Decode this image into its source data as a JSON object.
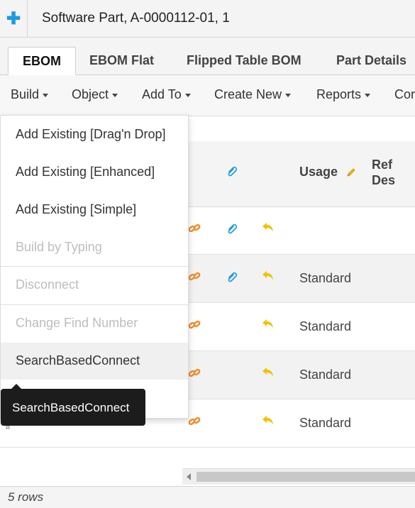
{
  "header": {
    "add_icon": "plus-icon",
    "title": "Software Part, A-0000112-01, 1"
  },
  "tabs": [
    {
      "label": "EBOM",
      "active": true
    },
    {
      "label": "EBOM Flat"
    },
    {
      "label": "Flipped Table BOM"
    },
    {
      "label": "Part Details"
    }
  ],
  "toolbar": {
    "menus": [
      "Build",
      "Object",
      "Add To",
      "Create New",
      "Reports",
      "Cor"
    ]
  },
  "grid": {
    "headers": {
      "usage": "Usage",
      "ref_des": "Ref Des"
    },
    "rows": [
      {
        "usage": ""
      },
      {
        "usage": "Standard"
      },
      {
        "usage": "Standard"
      },
      {
        "usage": "Standard"
      },
      {
        "usage": "Standard"
      }
    ]
  },
  "build_menu": {
    "items": [
      {
        "label": "Add Existing [Drag'n Drop]",
        "enabled": true
      },
      {
        "label": "Add Existing [Enhanced]",
        "enabled": true
      },
      {
        "label": "Add Existing [Simple]",
        "enabled": true
      },
      {
        "label": "Build by Typing",
        "enabled": false
      },
      {
        "label": "Disconnect",
        "enabled": false
      },
      {
        "label": "Change Find Number",
        "enabled": false
      },
      {
        "label": "SearchBasedConnect",
        "enabled": true,
        "hover": true
      }
    ]
  },
  "tooltip": {
    "text": "SearchBasedConnect"
  },
  "footer": {
    "row_count": "5 rows"
  },
  "colors": {
    "accent": "#1a9be0",
    "link_icon": "#f08a24",
    "return_icon": "#f2c200",
    "tooltip_bg": "#1c1c1c"
  }
}
